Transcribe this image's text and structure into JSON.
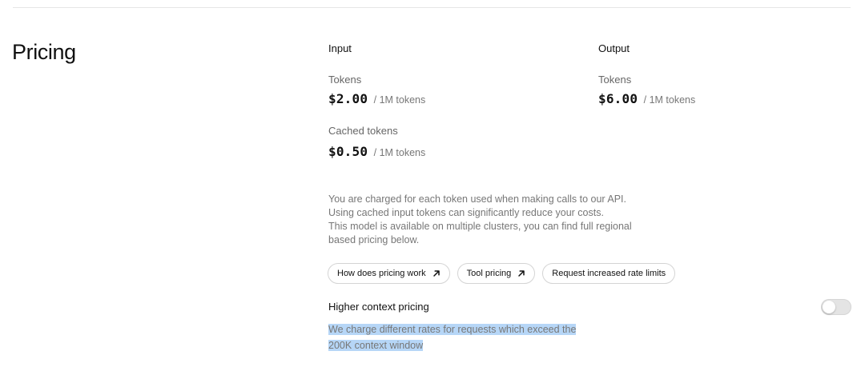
{
  "section": {
    "title": "Pricing"
  },
  "input": {
    "heading": "Input",
    "tokens": {
      "label": "Tokens",
      "price": "$2.00",
      "unit": "/ 1M tokens"
    },
    "cached": {
      "label": "Cached tokens",
      "price": "$0.50",
      "unit": "/ 1M tokens"
    }
  },
  "output": {
    "heading": "Output",
    "tokens": {
      "label": "Tokens",
      "price": "$6.00",
      "unit": "/ 1M tokens"
    }
  },
  "description": {
    "line1": "You are charged for each token used when making calls to our API.",
    "line2": "Using cached input tokens can significantly reduce your costs.",
    "line3": "This model is available on multiple clusters, you can find full regional",
    "line4": "based pricing below."
  },
  "buttons": {
    "how_pricing": "How does pricing work",
    "tool_pricing": "Tool pricing",
    "rate_limits": "Request increased rate limits"
  },
  "higher_context": {
    "title": "Higher context pricing",
    "desc_line1": "We charge different rates for requests which exceed the",
    "desc_line2": "200K context window",
    "toggle_on": false
  },
  "colors": {
    "highlight": "#b6d6f7",
    "toggle_off": "#e4e4e4"
  },
  "icons": {
    "external": "arrow-up-right-icon"
  }
}
